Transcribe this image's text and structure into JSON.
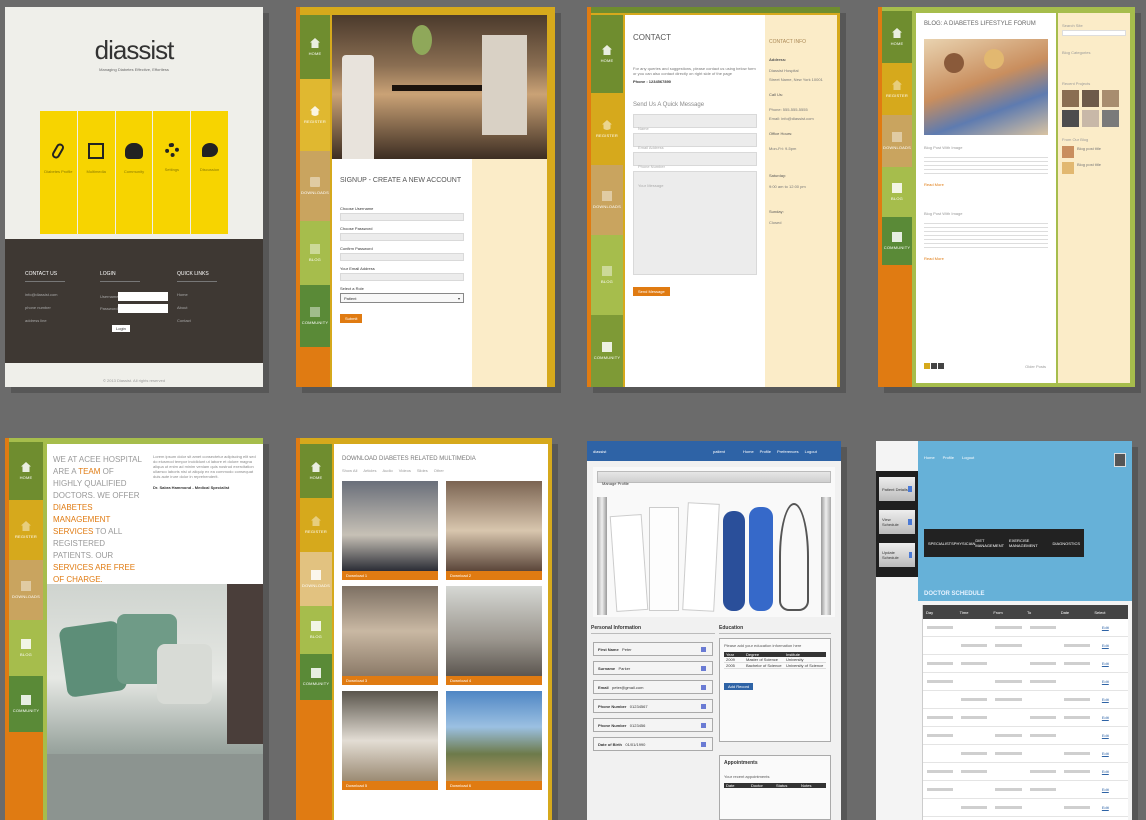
{
  "gallery_title": "Website screenshot collage",
  "colors": {
    "orange": "#e07b12",
    "olive": "#6f8d2f",
    "mustard": "#d6a91c",
    "khaki": "#c9a45f",
    "cream": "#fbecc8",
    "navy": "#2e63a6",
    "sky": "#66b1d8",
    "yellow": "#f7d400",
    "dark": "#3e3833"
  },
  "shot1": {
    "logo": "diassist",
    "tagline": "Managing Diabetes Effective, Effortless",
    "tiles": [
      "Diabetes Profile",
      "Multimedia",
      "Community",
      "Settings",
      "Discussion"
    ],
    "tile_icons": [
      "paperclip-icon",
      "picture-icon",
      "people-icon",
      "gear-icon",
      "chat-icon"
    ],
    "footer_cols": [
      "CONTACT US",
      "LOGIN",
      "QUICK LINKS"
    ],
    "contact_lines": [
      "info@diassist.com",
      "phone number",
      "address line"
    ],
    "login_labels": [
      "Username",
      "Password"
    ],
    "login_button": "Login",
    "quick_links": [
      "Home",
      "About",
      "Contact"
    ],
    "copyright": "© 2013 Diassist. All rights reserved"
  },
  "nav": [
    "HOME",
    "REGISTER",
    "DOWNLOADS",
    "BLOG",
    "COMMUNITY"
  ],
  "shot2": {
    "heading": "SIGNUP - CREATE A NEW ACCOUNT",
    "fields": [
      "Choose Username",
      "Choose Password",
      "Confirm Password",
      "Your Email Address",
      "Select a Role"
    ],
    "select_value": "Patient",
    "submit": "Submit"
  },
  "shot3": {
    "heading": "CONTACT",
    "intro": "For any queries and suggestions, please contact us using below form or you can also contact directly on right side of the page",
    "phone": "Phone : 1234567890",
    "form_title": "Send Us A Quick Message",
    "placeholders": [
      "Name",
      "Email Address",
      "Phone Number",
      "Your Message"
    ],
    "send_button": "Send Message",
    "side_title": "CONTACT INFO",
    "side_lines": [
      "Address:",
      "Diassist Hospital",
      "Street Name, New York 10001",
      "Call Us:",
      "Phone: 555-555-5555",
      "Email: info@diassist.com",
      "Office Hours:",
      "Mon-Fri: 9-5pm",
      "Saturday:",
      "9:00 am to 12:00 pm",
      "Sunday:",
      "Closed"
    ]
  },
  "shot4": {
    "heading": "BLOG: A DIABETES LIFESTYLE FORUM",
    "post_titles": [
      "Blog Post With Image",
      "Blog Post With Image"
    ],
    "read_more": "Read More",
    "search_label": "Search Site",
    "widgets": [
      "Blog Categories",
      "Recent Projects",
      "From Our Blog"
    ],
    "side_posts": [
      "Blog post title",
      "Blog post title"
    ],
    "older": "Older Posts"
  },
  "shot5": {
    "headline_parts": [
      "WE AT ACEE HOSPITAL ARE A ",
      "TEAM",
      "OF HIGHLY QUALIFIED DOCTORS. WE OFFER ",
      "DIABETES MANAGEMENT SERVICES",
      "TO ALL REGISTERED PATIENTS. OUR ",
      "SERVICES ARE FREE OF CHARGE."
    ],
    "body": "Lorem ipsum dolor sit amet consectetur adipiscing elit sed do eiusmod tempor incididunt ut labore et dolore magna aliqua ut enim ad minim veniam quis nostrud exercitation ullamco laboris nisi ut aliquip ex ea commodo consequat duis aute irure dolor in reprehenderit.",
    "signature": "Dr. Sabra Hammond - Medical Specialist"
  },
  "shot6": {
    "heading": "DOWNLOAD DIABETES RELATED MULTIMEDIA",
    "filters": [
      "Show All",
      "Articles",
      "Audio",
      "Videos",
      "Slides",
      "Other"
    ],
    "captions": [
      "Download 1",
      "Download 2",
      "Download 3",
      "Download 4",
      "Download 5",
      "Download 6"
    ]
  },
  "shot7": {
    "brand": "diassist",
    "user": "patient",
    "nav": [
      "Home",
      "Profile",
      "Preferences",
      "Logout"
    ],
    "bar_title": "Manage Profile",
    "sec1": "Personal Information",
    "sec2": "Education",
    "fields": [
      [
        "First Name",
        "Peter"
      ],
      [
        "Surname",
        "Parker"
      ],
      [
        "Email",
        "peter@gmail.com"
      ],
      [
        "Phone Number",
        "01234567"
      ],
      [
        "Phone Number",
        "0123456"
      ],
      [
        "Date of Birth",
        "01/01/1990"
      ]
    ],
    "edu_text": "Please add your education information here",
    "edu_cols": [
      "Year",
      "Degree",
      "Institute"
    ],
    "edu_rows": [
      [
        "2009",
        "Master of Science",
        "University"
      ],
      [
        "2005",
        "Bachelor of Science",
        "University of Science"
      ]
    ],
    "add_button": "Add Record",
    "sec3": "Appointments",
    "appt_text": "Your recent appointments",
    "appt_cols": [
      "Date",
      "Doctor",
      "Status",
      "Notes"
    ]
  },
  "shot8": {
    "top_nav": [
      "Home",
      "Profile",
      "Logout"
    ],
    "side_buttons": [
      "Patient Details",
      "View Schedule",
      "Update Schedule"
    ],
    "tabs": [
      "SPECIALISTS",
      "PHYSICIAN",
      "DIET MANAGEMENT",
      "EXERCISE MANAGEMENT",
      "DIAGNOSTICS"
    ],
    "table_title": "DOCTOR SCHEDULE",
    "cols": [
      "Day",
      "Time",
      "From",
      "To",
      "Date",
      "Select"
    ],
    "rows": 11,
    "edit_label": "Edit"
  }
}
